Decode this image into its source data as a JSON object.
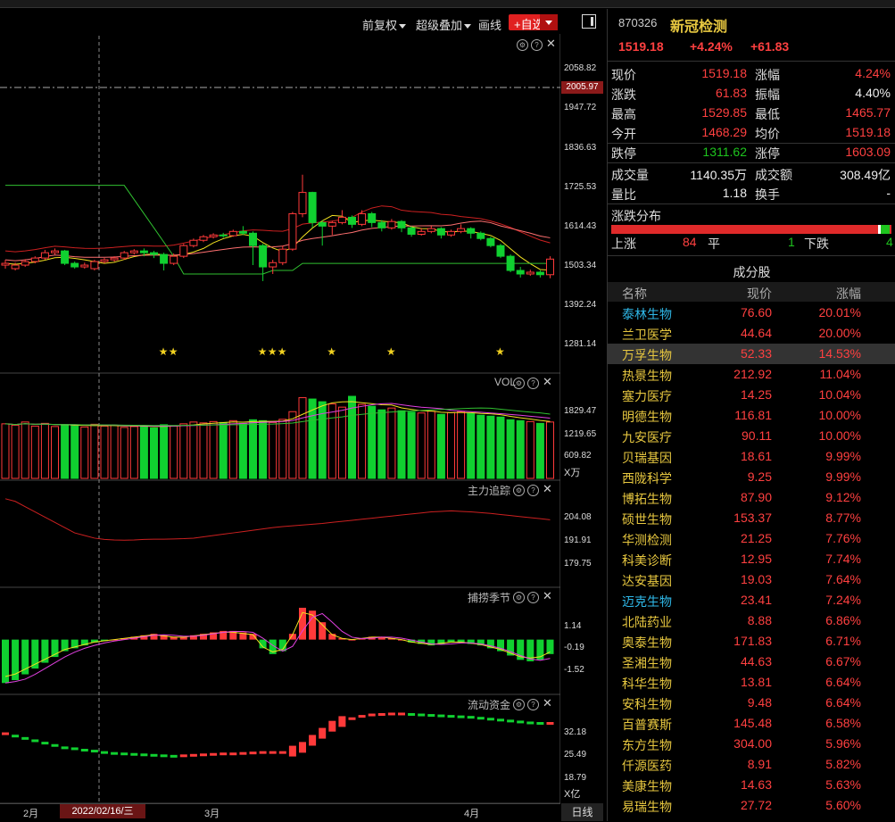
{
  "toolbar": {
    "adjust_label": "前复权",
    "overlay_label": "超级叠加",
    "draw_label": "画线",
    "add_fav_label": "+自选"
  },
  "stock": {
    "code": "870326",
    "name": "新冠检测",
    "price": "1519.18",
    "change_pct": "+4.24%",
    "change": "+61.83"
  },
  "quote": [
    {
      "k1": "现价",
      "v1": "1519.18",
      "c1": "red",
      "k2": "涨幅",
      "v2": "4.24%",
      "c2": "red"
    },
    {
      "k1": "涨跌",
      "v1": "61.83",
      "c1": "red",
      "k2": "振幅",
      "v2": "4.40%",
      "c2": "white"
    },
    {
      "k1": "最高",
      "v1": "1529.85",
      "c1": "red",
      "k2": "最低",
      "v2": "1465.77",
      "c2": "red"
    },
    {
      "k1": "今开",
      "v1": "1468.29",
      "c1": "red",
      "k2": "均价",
      "v2": "1519.18",
      "c2": "red"
    },
    {
      "k1": "跌停",
      "v1": "1311.62",
      "c1": "green",
      "k2": "涨停",
      "v2": "1603.09",
      "c2": "red"
    },
    {
      "k1": "成交量",
      "v1": "1140.35万",
      "c1": "white",
      "k2": "成交额",
      "v2": "308.49亿",
      "c2": "white"
    },
    {
      "k1": "量比",
      "v1": "1.18",
      "c1": "white",
      "k2": "换手",
      "v2": "-",
      "c2": "white"
    }
  ],
  "distribution": {
    "title": "涨跌分布",
    "up_label": "上涨",
    "up": "84",
    "flat_label": "平",
    "flat": "1",
    "down_label": "下跌",
    "down": "4"
  },
  "constituents": {
    "title": "成分股",
    "headers": {
      "name": "名称",
      "price": "现价",
      "change": "涨幅"
    },
    "rows": [
      {
        "name": "泰林生物",
        "price": "76.60",
        "change": "20.01%",
        "nc": "cyan"
      },
      {
        "name": "兰卫医学",
        "price": "44.64",
        "change": "20.00%",
        "nc": "yellow"
      },
      {
        "name": "万孚生物",
        "price": "52.33",
        "change": "14.53%",
        "nc": "yellow",
        "sel": true
      },
      {
        "name": "热景生物",
        "price": "212.92",
        "change": "11.04%",
        "nc": "yellow"
      },
      {
        "name": "塞力医疗",
        "price": "14.25",
        "change": "10.04%",
        "nc": "yellow"
      },
      {
        "name": "明德生物",
        "price": "116.81",
        "change": "10.00%",
        "nc": "yellow"
      },
      {
        "name": "九安医疗",
        "price": "90.11",
        "change": "10.00%",
        "nc": "yellow"
      },
      {
        "name": "贝瑞基因",
        "price": "18.61",
        "change": "9.99%",
        "nc": "yellow"
      },
      {
        "name": "西陇科学",
        "price": "9.25",
        "change": "9.99%",
        "nc": "yellow"
      },
      {
        "name": "博拓生物",
        "price": "87.90",
        "change": "9.12%",
        "nc": "yellow"
      },
      {
        "name": "硕世生物",
        "price": "153.37",
        "change": "8.77%",
        "nc": "yellow"
      },
      {
        "name": "华测检测",
        "price": "21.25",
        "change": "7.76%",
        "nc": "yellow"
      },
      {
        "name": "科美诊断",
        "price": "12.95",
        "change": "7.74%",
        "nc": "yellow"
      },
      {
        "name": "达安基因",
        "price": "19.03",
        "change": "7.64%",
        "nc": "yellow"
      },
      {
        "name": "迈克生物",
        "price": "23.41",
        "change": "7.24%",
        "nc": "cyan"
      },
      {
        "name": "北陆药业",
        "price": "8.88",
        "change": "6.86%",
        "nc": "yellow"
      },
      {
        "name": "奥泰生物",
        "price": "171.83",
        "change": "6.71%",
        "nc": "yellow"
      },
      {
        "name": "圣湘生物",
        "price": "44.63",
        "change": "6.67%",
        "nc": "yellow"
      },
      {
        "name": "科华生物",
        "price": "13.81",
        "change": "6.64%",
        "nc": "yellow"
      },
      {
        "name": "安科生物",
        "price": "9.48",
        "change": "6.64%",
        "nc": "yellow"
      },
      {
        "name": "百普赛斯",
        "price": "145.48",
        "change": "6.58%",
        "nc": "yellow"
      },
      {
        "name": "东方生物",
        "price": "304.00",
        "change": "5.96%",
        "nc": "yellow"
      },
      {
        "name": "仟源医药",
        "price": "8.91",
        "change": "5.82%",
        "nc": "yellow"
      },
      {
        "name": "美康生物",
        "price": "14.63",
        "change": "5.63%",
        "nc": "yellow"
      },
      {
        "name": "易瑞生物",
        "price": "27.72",
        "change": "5.60%",
        "nc": "yellow"
      }
    ]
  },
  "chart": {
    "price_axis": [
      "2058.82",
      "1947.72",
      "1836.63",
      "1725.53",
      "1614.43",
      "1503.34",
      "1392.24",
      "1281.14"
    ],
    "current_price_tag": "2005.97",
    "vol_label": "VOL",
    "vol_axis": [
      "1829.47",
      "1219.65",
      "609.82"
    ],
    "vol_unit": "X万",
    "track_label": "主力追踪",
    "track_axis": [
      "204.08",
      "191.91",
      "179.75"
    ],
    "season_label": "捕捞季节",
    "season_axis": [
      "1.14",
      "-0.19",
      "-1.52"
    ],
    "flow_label": "流动资金",
    "flow_axis": [
      "32.18",
      "25.49",
      "18.79"
    ],
    "flow_unit": "X亿",
    "months": [
      "2月",
      "3月",
      "4月"
    ],
    "cursor_date": "2022/02/16/三",
    "period": "日线"
  },
  "colors": {
    "up": "#ff3a3a",
    "down": "#10d030",
    "accent": "#e8c840"
  },
  "chart_data": {
    "type": "candlestick",
    "price_ylim": [
      1281.14,
      2058.82
    ],
    "candles": [
      [
        1505,
        1510,
        1520,
        1495
      ],
      [
        1495,
        1505,
        1512,
        1490
      ],
      [
        1505,
        1515,
        1522,
        1500
      ],
      [
        1515,
        1525,
        1530,
        1510
      ],
      [
        1525,
        1540,
        1548,
        1520
      ],
      [
        1540,
        1545,
        1552,
        1535
      ],
      [
        1545,
        1510,
        1548,
        1505
      ],
      [
        1510,
        1500,
        1515,
        1495
      ],
      [
        1500,
        1505,
        1512,
        1495
      ],
      [
        1495,
        1515,
        1520,
        1490
      ],
      [
        1515,
        1520,
        1525,
        1510
      ],
      [
        1520,
        1525,
        1530,
        1515
      ],
      [
        1525,
        1540,
        1545,
        1520
      ],
      [
        1540,
        1545,
        1550,
        1535
      ],
      [
        1545,
        1540,
        1552,
        1530
      ],
      [
        1540,
        1535,
        1545,
        1525
      ],
      [
        1535,
        1510,
        1540,
        1490
      ],
      [
        1510,
        1530,
        1538,
        1505
      ],
      [
        1530,
        1560,
        1565,
        1525
      ],
      [
        1560,
        1575,
        1580,
        1555
      ],
      [
        1575,
        1585,
        1590,
        1570
      ],
      [
        1585,
        1590,
        1595,
        1580
      ],
      [
        1590,
        1588,
        1596,
        1582
      ],
      [
        1588,
        1600,
        1605,
        1585
      ],
      [
        1600,
        1595,
        1615,
        1590
      ],
      [
        1595,
        1560,
        1600,
        1505
      ],
      [
        1560,
        1500,
        1565,
        1460
      ],
      [
        1500,
        1512,
        1520,
        1480
      ],
      [
        1512,
        1550,
        1560,
        1505
      ],
      [
        1550,
        1650,
        1655,
        1545
      ],
      [
        1650,
        1710,
        1760,
        1640
      ],
      [
        1710,
        1625,
        1712,
        1610
      ],
      [
        1625,
        1615,
        1630,
        1560
      ],
      [
        1615,
        1625,
        1630,
        1590
      ],
      [
        1625,
        1640,
        1660,
        1620
      ],
      [
        1640,
        1620,
        1645,
        1610
      ],
      [
        1620,
        1650,
        1660,
        1615
      ],
      [
        1650,
        1625,
        1655,
        1612
      ],
      [
        1625,
        1610,
        1632,
        1600
      ],
      [
        1610,
        1628,
        1635,
        1605
      ],
      [
        1628,
        1610,
        1632,
        1598
      ],
      [
        1610,
        1592,
        1615,
        1585
      ],
      [
        1592,
        1600,
        1610,
        1588
      ],
      [
        1600,
        1608,
        1615,
        1595
      ],
      [
        1608,
        1590,
        1612,
        1580
      ],
      [
        1590,
        1600,
        1605,
        1585
      ],
      [
        1600,
        1608,
        1620,
        1595
      ],
      [
        1608,
        1595,
        1612,
        1580
      ],
      [
        1595,
        1580,
        1600,
        1575
      ],
      [
        1580,
        1560,
        1585,
        1555
      ],
      [
        1560,
        1530,
        1565,
        1525
      ],
      [
        1530,
        1490,
        1535,
        1485
      ],
      [
        1490,
        1480,
        1500,
        1470
      ],
      [
        1480,
        1485,
        1492,
        1475
      ],
      [
        1485,
        1478,
        1490,
        1470
      ],
      [
        1478,
        1522,
        1530,
        1468
      ]
    ],
    "stars": [
      16,
      17,
      26,
      27,
      28,
      33,
      39,
      50
    ],
    "volume": [
      1210,
      1180,
      1250,
      1160,
      1220,
      1150,
      1190,
      1170,
      1140,
      1200,
      1160,
      1180,
      1130,
      1150,
      1170,
      1120,
      1190,
      1160,
      1210,
      1250,
      1230,
      1260,
      1240,
      1280,
      1220,
      1300,
      1280,
      1240,
      1310,
      1480,
      1790,
      1760,
      1700,
      1650,
      1580,
      1820,
      1640,
      1600,
      1520,
      1560,
      1500,
      1470,
      1450,
      1490,
      1420,
      1460,
      1480,
      1440,
      1400,
      1380,
      1360,
      1300,
      1280,
      1260,
      1220,
      1250
    ],
    "track": [
      207,
      206,
      204,
      202,
      200,
      198,
      196,
      194,
      193,
      192,
      191.5,
      191.3,
      191.2,
      191.3,
      191.5,
      191.6,
      191.6,
      191.7,
      191.8,
      192,
      192.5,
      193,
      193.5,
      194,
      194.5,
      195,
      195.5,
      196,
      196.4,
      196.7,
      197,
      197.3,
      197.6,
      198,
      198.4,
      198.8,
      199.2,
      199.6,
      200,
      200.4,
      200.8,
      201.2,
      201.6,
      202,
      202.2,
      202.4,
      202.2,
      202,
      201.7,
      201.4,
      201,
      200.6,
      200.2,
      199.8,
      199.4,
      199
    ],
    "season": [
      -1.5,
      -1.4,
      -1.2,
      -1.0,
      -0.8,
      -0.6,
      -0.4,
      -0.3,
      -0.2,
      -0.1,
      -0.05,
      0,
      0.05,
      0.1,
      0.15,
      0.2,
      0.15,
      0.1,
      0.1,
      0.15,
      0.2,
      0.25,
      0.3,
      0.3,
      0.25,
      0.2,
      -0.3,
      -0.5,
      -0.4,
      0.2,
      1.1,
      1.0,
      0.6,
      0.2,
      0.05,
      0,
      0.05,
      0.1,
      0.1,
      0.05,
      0,
      -0.1,
      -0.15,
      -0.2,
      -0.15,
      -0.1,
      -0.1,
      -0.15,
      -0.2,
      -0.3,
      -0.4,
      -0.55,
      -0.7,
      -0.75,
      -0.7,
      -0.5
    ],
    "flow": [
      30,
      29.5,
      29,
      28.5,
      28,
      27.5,
      27,
      26.8,
      26.5,
      26.3,
      26,
      25.8,
      25.7,
      25.6,
      25.5,
      25.4,
      25.3,
      25.2,
      25.3,
      25.4,
      25.5,
      25.6,
      25.7,
      25.7,
      25.8,
      25.9,
      26,
      26,
      26,
      26.2,
      27,
      28.5,
      30,
      31.5,
      32.5,
      33.2,
      33.7,
      34,
      34.1,
      34.2,
      34.2,
      34.1,
      34,
      33.9,
      33.8,
      33.7,
      33.6,
      33.5,
      33.3,
      33.1,
      32.9,
      32.7,
      32.5,
      32.3,
      32.2,
      32.2
    ]
  }
}
